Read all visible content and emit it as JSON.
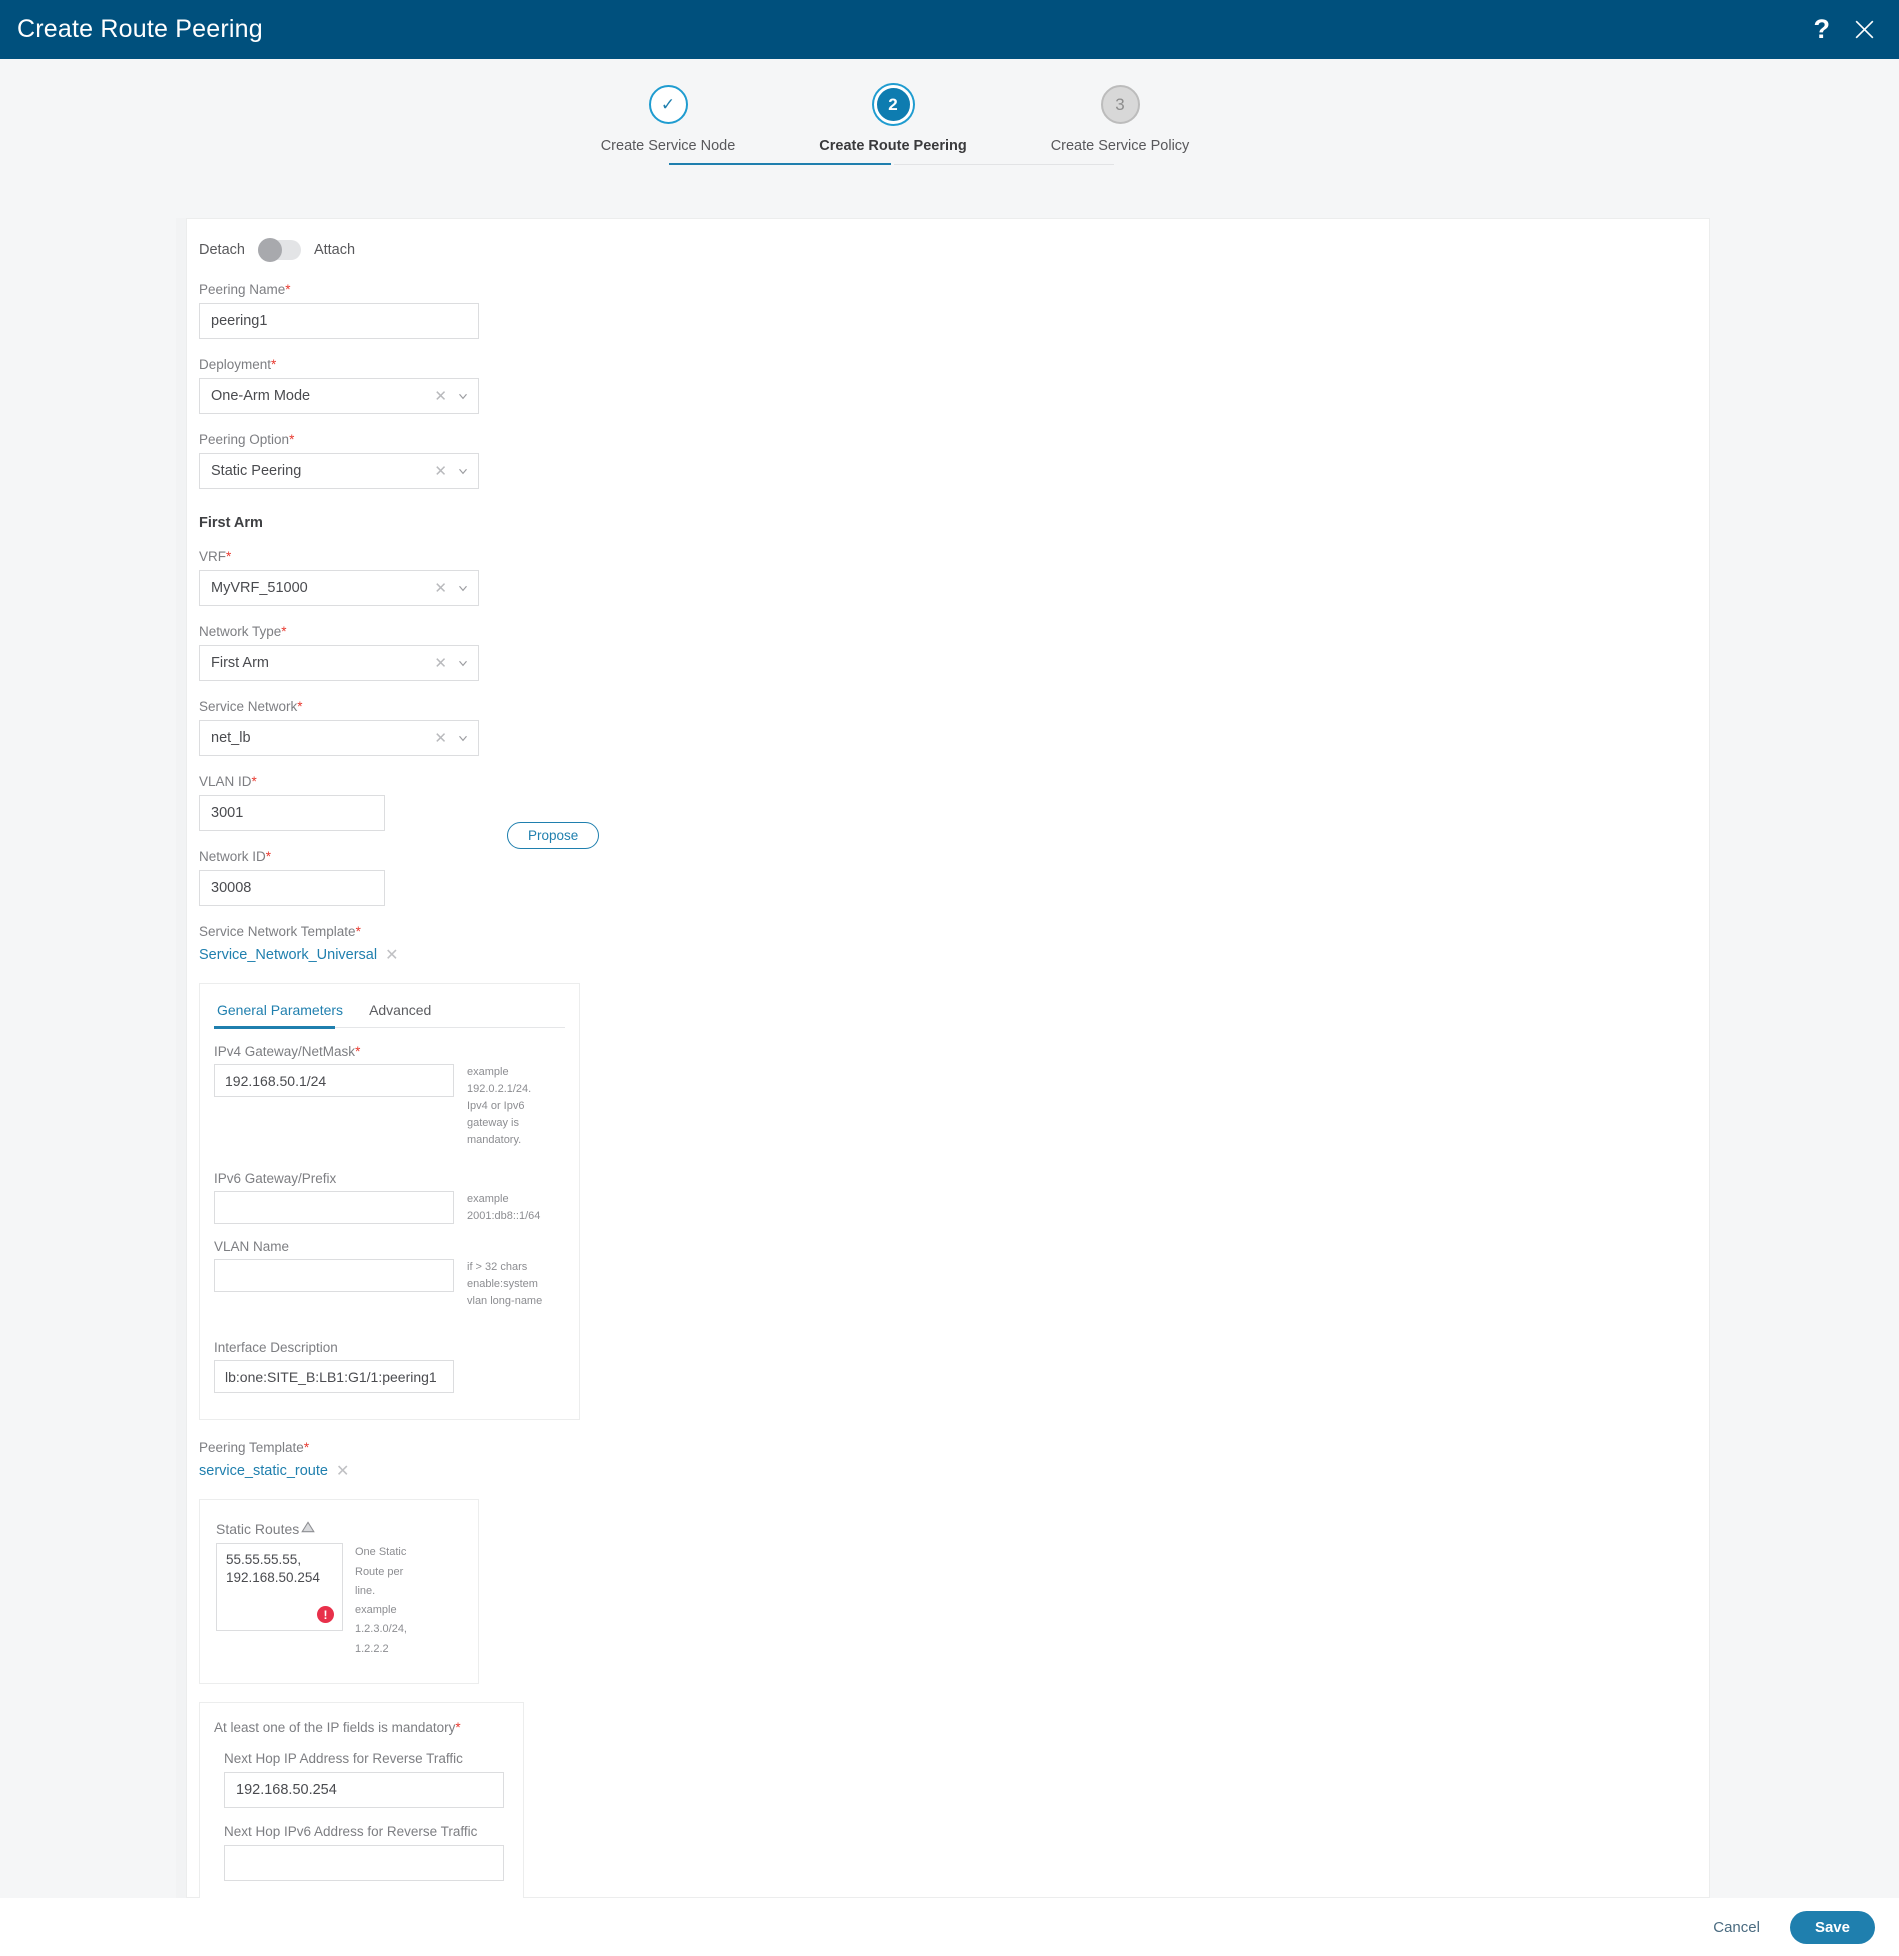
{
  "header": {
    "title": "Create Route Peering",
    "help_icon": "question-mark-icon",
    "close_icon": "close-icon"
  },
  "stepper": {
    "steps": [
      {
        "number": "✓",
        "label": "Create Service Node",
        "state": "done"
      },
      {
        "number": "2",
        "label": "Create Route Peering",
        "state": "active"
      },
      {
        "number": "3",
        "label": "Create Service Policy",
        "state": "todo"
      }
    ]
  },
  "form": {
    "toggle": {
      "left_label": "Detach",
      "right_label": "Attach",
      "state": "detach"
    },
    "peering_name": {
      "label": "Peering Name",
      "required": "*",
      "value": "peering1"
    },
    "deployment": {
      "label": "Deployment",
      "required": "*",
      "value": "One-Arm Mode"
    },
    "peering_option": {
      "label": "Peering Option",
      "required": "*",
      "value": "Static Peering"
    },
    "section_first_arm": "First Arm",
    "vrf": {
      "label": "VRF",
      "required": "*",
      "value": "MyVRF_51000"
    },
    "network_type": {
      "label": "Network Type",
      "required": "*",
      "value": "First Arm"
    },
    "service_network": {
      "label": "Service Network",
      "required": "*",
      "value": "net_lb"
    },
    "vlan_id": {
      "label": "VLAN ID",
      "required": "*",
      "value": "3001"
    },
    "propose_button": "Propose",
    "network_id": {
      "label": "Network ID",
      "required": "*",
      "value": "30008"
    },
    "service_network_template": {
      "label": "Service Network Template",
      "required": "*",
      "value": "Service_Network_Universal"
    },
    "tabs": [
      {
        "label": "General Parameters",
        "active": true
      },
      {
        "label": "Advanced",
        "active": false
      }
    ],
    "ipv4_gateway": {
      "label": "IPv4 Gateway/NetMask",
      "required": "*",
      "value": "192.168.50.1/24",
      "hint": "example 192.0.2.1/24. Ipv4 or Ipv6 gateway is mandatory."
    },
    "ipv6_gateway": {
      "label": "IPv6 Gateway/Prefix",
      "value": "",
      "hint": "example 2001:db8::1/64"
    },
    "vlan_name": {
      "label": "VLAN Name",
      "value": "",
      "hint": "if > 32 chars enable:system vlan long-name"
    },
    "interface_description": {
      "label": "Interface Description",
      "value": "lb:one:SITE_B:LB1:G1/1:peering1"
    },
    "peering_template": {
      "label": "Peering Template",
      "required": "*",
      "value": "service_static_route"
    },
    "static_routes": {
      "label": "Static Routes",
      "warning_icon": "warning-triangle-icon",
      "value": "55.55.55.55,\n192.168.50.254",
      "error_icon": "error-exclamation-icon",
      "hint": "One Static Route per line. example 1.2.3.0/24, 1.2.2.2"
    },
    "ip_fields_group": {
      "title": "At least one of the IP fields is mandatory",
      "required": "*",
      "next_hop_ip": {
        "label": "Next Hop IP Address for Reverse Traffic",
        "value": "192.168.50.254"
      },
      "next_hop_ipv6": {
        "label": "Next Hop IPv6 Address for Reverse Traffic",
        "value": ""
      }
    }
  },
  "footer": {
    "cancel_label": "Cancel",
    "save_label": "Save"
  },
  "colors": {
    "header_bg": "#00507d",
    "accent": "#1f7fae",
    "required": "#e8392f",
    "error": "#e8304a",
    "page_bg": "#f5f6f7"
  }
}
